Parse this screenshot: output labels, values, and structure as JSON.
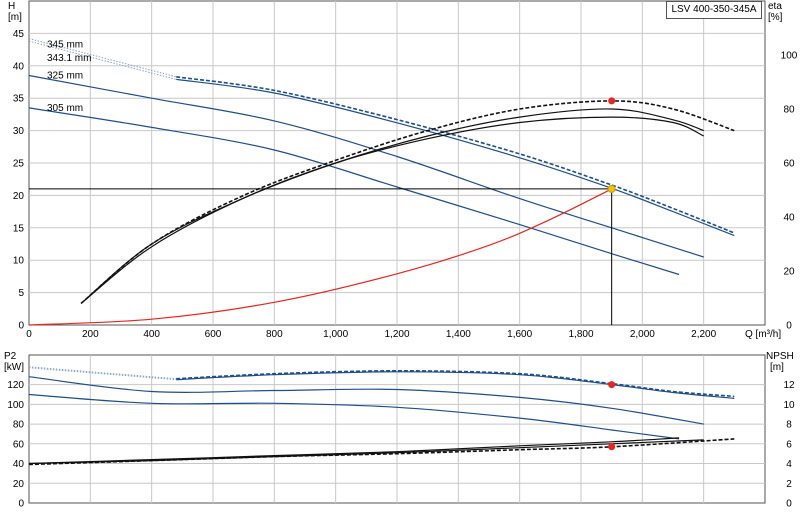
{
  "model_label": "LSV 400-350-345A",
  "colors": {
    "curve": "#1f4e8c",
    "efficiency": "#111111",
    "system": "#e8261c",
    "grid": "#c8c8c8",
    "dutypoint": "#f5c400"
  },
  "chart_data": [
    {
      "type": "line",
      "name": "performance",
      "xlabel": "Q [m³/h]",
      "ylabel": "H [m]",
      "y2label": "eta [%]",
      "xlim": [
        0,
        2400
      ],
      "ylim": [
        0,
        50
      ],
      "y2lim": [
        0,
        120
      ],
      "x_ticks": [
        0,
        200,
        400,
        600,
        800,
        1000,
        1200,
        1400,
        1600,
        1800,
        2000,
        2200
      ],
      "x_tick_labels": [
        "0",
        "200",
        "400",
        "600",
        "800",
        "1,000",
        "1,200",
        "1,400",
        "1,600",
        "1,800",
        "2,000",
        "2,200"
      ],
      "y_ticks": [
        0,
        5,
        10,
        15,
        20,
        25,
        30,
        35,
        40,
        45
      ],
      "y_tick_labels": [
        "0",
        "5",
        "10",
        "15",
        "20",
        "25",
        "30",
        "35",
        "40",
        "45"
      ],
      "y2_ticks": [
        0,
        20,
        40,
        60,
        80,
        100
      ],
      "y2_tick_labels": [
        "0",
        "20",
        "40",
        "60",
        "80",
        "100"
      ],
      "grid": true,
      "series": [
        {
          "name": "345 mm",
          "style": "dashed",
          "color": "#1f4e8c",
          "extrap_start": [
            [
              0,
              44.2
            ],
            [
              480,
              38.3
            ]
          ],
          "x": [
            480,
            800,
            1200,
            1600,
            1900,
            2100,
            2300
          ],
          "y": [
            38.3,
            36.2,
            31.7,
            26.4,
            21.6,
            18.0,
            14.2
          ]
        },
        {
          "name": "343.1 mm",
          "style": "solid",
          "color": "#1f4e8c",
          "extrap_start": [
            [
              0,
              43.8
            ],
            [
              480,
              37.9
            ]
          ],
          "x": [
            480,
            800,
            1200,
            1600,
            1900,
            2100,
            2300
          ],
          "y": [
            37.9,
            35.8,
            31.2,
            25.8,
            21.1,
            17.5,
            13.8
          ]
        },
        {
          "name": "325 mm",
          "style": "solid",
          "color": "#1f4e8c",
          "x": [
            0,
            400,
            800,
            1200,
            1600,
            1900,
            2200
          ],
          "y": [
            38.5,
            35.0,
            31.5,
            26.0,
            19.5,
            15.0,
            10.5
          ]
        },
        {
          "name": "305 mm",
          "style": "solid",
          "color": "#1f4e8c",
          "x": [
            0,
            400,
            800,
            1200,
            1600,
            1900,
            2120
          ],
          "y": [
            33.5,
            30.5,
            27.0,
            21.3,
            15.5,
            11.0,
            7.8
          ]
        },
        {
          "name": "",
          "axis": "y2",
          "style": "dashed",
          "color": "#111111",
          "x": [
            170,
            400,
            700,
            1000,
            1300,
            1600,
            1900,
            2100,
            2300
          ],
          "y": [
            8,
            30,
            48,
            61,
            72,
            80,
            83,
            80,
            72
          ]
        },
        {
          "name": "",
          "axis": "y2",
          "style": "solid",
          "color": "#111111",
          "x": [
            170,
            400,
            700,
            1000,
            1300,
            1600,
            1900,
            2100,
            2200
          ],
          "y": [
            8,
            30,
            47,
            60,
            70,
            77,
            80,
            76,
            72
          ]
        },
        {
          "name": "",
          "axis": "y2",
          "style": "solid",
          "color": "#111111",
          "x": [
            170,
            400,
            700,
            1000,
            1300,
            1600,
            1900,
            2100,
            2200
          ],
          "y": [
            8,
            29,
            47,
            60,
            69,
            75,
            77,
            75,
            70
          ]
        },
        {
          "name": "",
          "style": "solid",
          "color": "#e8261c",
          "x": [
            0,
            400,
            800,
            1200,
            1500,
            1700,
            1900
          ],
          "y": [
            0,
            0.9,
            3.5,
            7.9,
            12.3,
            16.3,
            21.0
          ]
        }
      ],
      "markers": [
        {
          "type": "efficiency-point",
          "x": 1900,
          "y2": 83,
          "color": "#e8261c"
        },
        {
          "type": "duty-point",
          "x": 1900,
          "y": 21,
          "color": "#f5c400"
        }
      ],
      "duty_point": {
        "x": 1900,
        "y": 21
      }
    },
    {
      "type": "line",
      "name": "power-npsh",
      "ylabel": "P2 [kW]",
      "y2label": "NPSH [m]",
      "xlim": [
        0,
        2400
      ],
      "ylim": [
        0,
        150
      ],
      "y2lim": [
        0,
        15
      ],
      "x_ticks": [
        0,
        200,
        400,
        600,
        800,
        1000,
        1200,
        1400,
        1600,
        1800,
        2000,
        2200
      ],
      "y_ticks": [
        0,
        20,
        40,
        60,
        80,
        100,
        120
      ],
      "y_tick_labels": [
        "0",
        "20",
        "40",
        "60",
        "80",
        "100",
        "120"
      ],
      "y2_ticks": [
        0,
        2,
        4,
        6,
        8,
        10,
        12
      ],
      "y2_tick_labels": [
        "0",
        "2",
        "4",
        "6",
        "8",
        "10",
        "12"
      ],
      "grid": true,
      "series": [
        {
          "name": "",
          "style": "dashed",
          "color": "#1f4e8c",
          "extrap_start": [
            [
              0,
              138
            ],
            [
              480,
              126
            ]
          ],
          "x": [
            480,
            800,
            1200,
            1600,
            1900,
            2100,
            2300
          ],
          "y": [
            126,
            131,
            134,
            131,
            121,
            113,
            108
          ]
        },
        {
          "name": "",
          "style": "solid",
          "color": "#1f4e8c",
          "extrap_start": [
            [
              0,
              137
            ],
            [
              480,
              125
            ]
          ],
          "x": [
            480,
            800,
            1200,
            1600,
            1900,
            2100,
            2300
          ],
          "y": [
            125,
            130,
            133,
            130,
            120,
            112,
            106
          ]
        },
        {
          "name": "",
          "style": "solid",
          "color": "#1f4e8c",
          "x": [
            0,
            400,
            800,
            1200,
            1600,
            1900,
            2200
          ],
          "y": [
            128,
            113,
            114,
            115,
            107,
            96,
            80
          ]
        },
        {
          "name": "",
          "style": "solid",
          "color": "#1f4e8c",
          "x": [
            0,
            400,
            800,
            1200,
            1600,
            1900,
            2120
          ],
          "y": [
            110,
            101,
            101,
            97,
            86,
            74,
            65
          ]
        },
        {
          "name": "",
          "axis": "y2",
          "style": "dashed",
          "color": "#111111",
          "x": [
            0,
            400,
            800,
            1200,
            1600,
            1900,
            2300
          ],
          "y": [
            3.9,
            4.3,
            4.7,
            5.0,
            5.4,
            5.7,
            6.5
          ]
        },
        {
          "name": "",
          "axis": "y2",
          "style": "solid",
          "color": "#111111",
          "x": [
            0,
            400,
            800,
            1200,
            1600,
            1900,
            2200
          ],
          "y": [
            4.0,
            4.3,
            4.7,
            5.1,
            5.6,
            6.0,
            6.4
          ]
        },
        {
          "name": "",
          "axis": "y2",
          "style": "solid",
          "color": "#111111",
          "x": [
            0,
            400,
            800,
            1200,
            1600,
            1900,
            2120
          ],
          "y": [
            4.0,
            4.4,
            4.8,
            5.2,
            5.8,
            6.2,
            6.6
          ]
        }
      ],
      "markers": [
        {
          "type": "power-point",
          "x": 1900,
          "y": 120,
          "color": "#e8261c"
        },
        {
          "type": "npsh-point",
          "x": 1900,
          "y2": 5.7,
          "color": "#e8261c"
        }
      ]
    }
  ]
}
